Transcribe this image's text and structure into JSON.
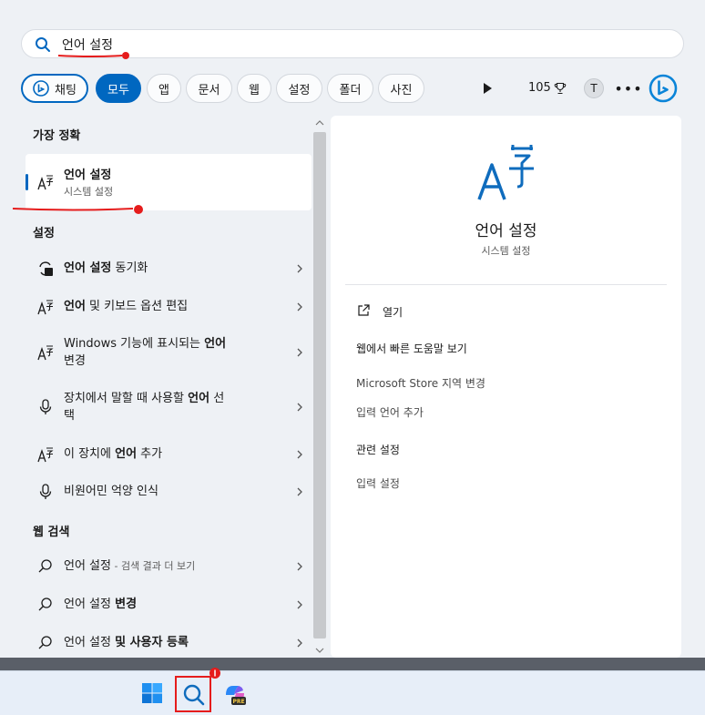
{
  "search": {
    "query": "언어 설정"
  },
  "filters": [
    "채팅",
    "모두",
    "앱",
    "문서",
    "웹",
    "설정",
    "폴더",
    "사진"
  ],
  "points": "105",
  "avatar": "T",
  "more": "•••",
  "left": {
    "best_header": "가장 정확",
    "best": {
      "title": "언어 설정",
      "subtitle": "시스템 설정"
    },
    "settings_header": "설정",
    "settings": [
      {
        "bold": "언어 설정",
        "rest": " 동기화"
      },
      {
        "bold": "언어",
        "rest": " 및 키보드 옵션 편집"
      },
      {
        "line1": "Windows 기능에 표시되는 ",
        "bold": "언어",
        "line2": "변경"
      },
      {
        "line1": "장치에서 말할 때 사용할 ",
        "bold": "언어",
        "rest1": " 선",
        "line2": "택"
      },
      {
        "pre": "이 장치에 ",
        "bold": "언어",
        "rest": " 추가"
      },
      {
        "plain": "비원어민 억양 인식"
      }
    ],
    "web_header": "웹 검색",
    "web": [
      {
        "plain": "언어 설정",
        "dim": " - 검색 결과 더 보기"
      },
      {
        "plain": "언어 설정 ",
        "bold": "변경"
      },
      {
        "plain": "언어 설정 ",
        "bold": "및 사용자 등록"
      }
    ]
  },
  "preview": {
    "title": "언어 설정",
    "subtitle": "시스템 설정",
    "open": "열기",
    "web_help_header": "웹에서 빠른 도움말 보기",
    "web_help": [
      "Microsoft Store 지역 변경",
      "입력 언어 추가"
    ],
    "related_header": "관련 설정",
    "related": [
      "입력 설정"
    ]
  },
  "colors": {
    "accent": "#0067c0",
    "annotation": "#e51c1c"
  }
}
